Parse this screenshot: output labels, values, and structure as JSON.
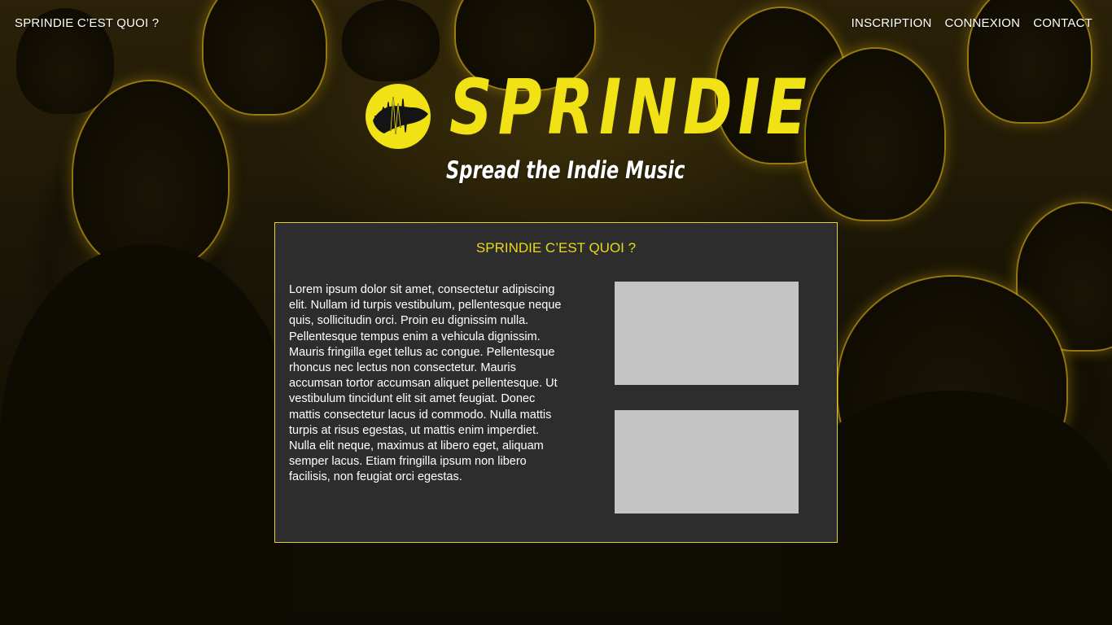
{
  "nav": {
    "left_label": "SPRINDIE C’EST QUOI ?",
    "items": [
      {
        "label": "INSCRIPTION"
      },
      {
        "label": "CONNEXION"
      },
      {
        "label": "CONTACT"
      }
    ]
  },
  "brand": {
    "name": "SPRINDIE",
    "tagline": "Spread the Indie Music",
    "logo_icon": "soundwave-circle-icon"
  },
  "about": {
    "title": "SPRINDIE C’EST QUOI ?",
    "text": "Lorem ipsum dolor sit amet, consectetur adipiscing elit. Nullam id turpis vestibulum, pellentesque neque quis, sollicitudin orci. Proin eu dignissim nulla. Pellentesque tempus enim a vehicula dignissim. Mauris fringilla eget tellus ac congue. Pellentesque rhoncus nec lectus non consectetur. Mauris accumsan tortor accumsan aliquet pellentesque. Ut vestibulum tincidunt elit sit amet feugiat. Donec mattis consectetur lacus id commodo. Nulla mattis turpis at risus egestas, ut mattis enim imperdiet. Nulla elit neque, maximus at libero eget, aliquam semper lacus. Etiam fringilla ipsum non libero facilisis, non feugiat orci egestas."
  },
  "colors": {
    "accent": "#f0e214",
    "panel_background": "#2d2d2d",
    "image_placeholder": "#c4c4c4"
  }
}
